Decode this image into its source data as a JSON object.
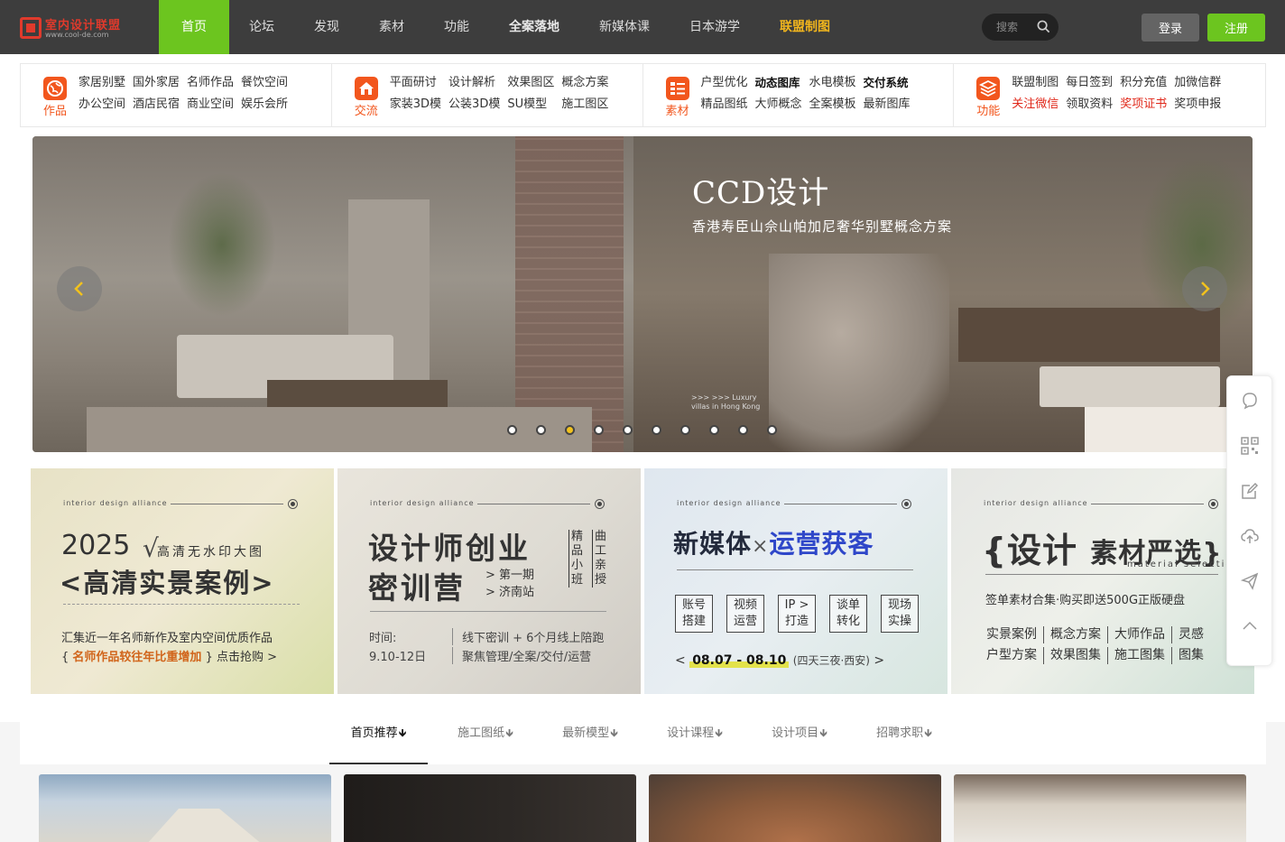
{
  "logo": {
    "title": "室内设计联盟",
    "url": "www.cool-de.com"
  },
  "nav": {
    "items": [
      {
        "label": "首页"
      },
      {
        "label": "论坛"
      },
      {
        "label": "发现"
      },
      {
        "label": "素材"
      },
      {
        "label": "功能"
      },
      {
        "label": "全案落地"
      },
      {
        "label": "新媒体课"
      },
      {
        "label": "日本游学"
      },
      {
        "label": "联盟制图"
      }
    ],
    "search_placeholder": "搜索",
    "login_label": "登录",
    "register_label": "注册"
  },
  "categories": [
    {
      "label": "作品",
      "icon": "globe-icon",
      "links": [
        "家居别墅",
        "国外家居",
        "名师作品",
        "餐饮空间",
        "办公空间",
        "酒店民宿",
        "商业空间",
        "娱乐会所"
      ]
    },
    {
      "label": "交流",
      "icon": "house-icon",
      "links": [
        "平面研讨",
        "设计解析",
        "效果图区",
        "概念方案",
        "家装3D模",
        "公装3D模",
        "SU模型",
        "施工图区"
      ]
    },
    {
      "label": "素材",
      "icon": "list-icon",
      "links": [
        "户型优化",
        "动态图库",
        "水电模板",
        "交付系统",
        "精品图纸",
        "大师概念",
        "全案模板",
        "最新图库"
      ]
    },
    {
      "label": "功能",
      "icon": "layers-icon",
      "links": [
        "联盟制图",
        "每日签到",
        "积分充值",
        "加微信群",
        "关注微信",
        "领取资料",
        "奖项证书",
        "奖项申报"
      ]
    }
  ],
  "banner": {
    "title": "CCD设计",
    "subtitle": "香港寿臣山佘山帕加尼奢华别墅概念方案",
    "small_text": ">>> >>> Luxury villas in Hong Kong",
    "slide_count": 10,
    "active_slide": 3
  },
  "promos": [
    {
      "header": "interior design alliance",
      "year": "2025",
      "radical": "√",
      "small_title": "高清无水印大图",
      "big_title": "<高清实景案例>",
      "desc1": "汇集近一年名师新作及室内空间优质作品",
      "desc2_pre": "{",
      "desc2_highlight": "名师作品较往年比重增加",
      "desc2_post": "} 点击抢购 >"
    },
    {
      "header": "interior design alliance",
      "title_line1": "设计师创业",
      "title_line2": "密训营",
      "session1": "> 第一期",
      "session2": "> 济南站",
      "vert1": "精品小班",
      "vert2": "曲工亲授",
      "time_label": "时间:",
      "time_value": "9.10-12日",
      "right1": "线下密训 + 6个月线上陪跑",
      "right2": "聚焦管理/全案/交付/运营"
    },
    {
      "header": "interior design alliance",
      "title_a": "新媒体",
      "title_x": "×",
      "title_b": "运营获客",
      "boxes": [
        {
          "l1": "账号",
          "l2": "搭建"
        },
        {
          "l1": "视频",
          "l2": "运营"
        },
        {
          "l1": "IP >",
          "l2": "打造"
        },
        {
          "l1": "谈单",
          "l2": "转化"
        },
        {
          "l1": "现场",
          "l2": "实操"
        }
      ],
      "date_pre": "<",
      "date": "08.07 - 08.10",
      "date_suffix": "(四天三夜·西安)",
      "date_post": ">"
    },
    {
      "header": "interior design alliance",
      "title_a": "{设计",
      "title_b": "素材严选}",
      "title_en": "material selection",
      "line1": "签单素材合集·购买即送500G正版硬盘",
      "grid": [
        "实景案例",
        "概念方案",
        "大师作品",
        "灵感",
        "户型方案",
        "效果图集",
        "施工图集",
        "图集"
      ]
    }
  ],
  "tabs": [
    {
      "label": "首页推荐"
    },
    {
      "label": "施工图纸"
    },
    {
      "label": "最新模型"
    },
    {
      "label": "设计课程"
    },
    {
      "label": "设计项目"
    },
    {
      "label": "招聘求职"
    }
  ],
  "colors": {
    "accent_green": "#6cc51f",
    "nav_bg": "#3d3d3d",
    "category_orange": "#f2561d",
    "highlight_gold": "#f2b61d",
    "link_red": "#e0281a"
  }
}
